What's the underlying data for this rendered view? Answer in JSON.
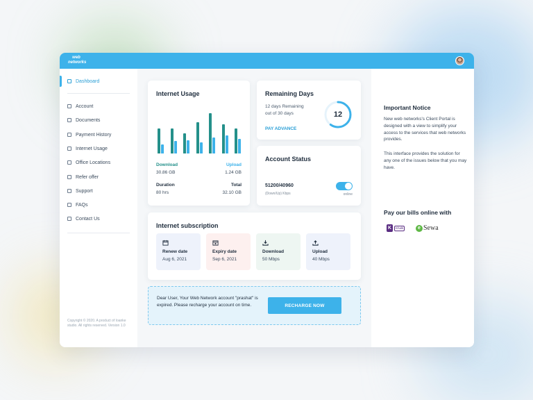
{
  "colors": {
    "accent": "#3db2ea",
    "download": "#24908a",
    "upload": "#3db2ea"
  },
  "header": {
    "logo_text": "web networks"
  },
  "sidebar": {
    "items": [
      {
        "label": "Dashboard",
        "icon": "grid-icon"
      },
      {
        "label": "Account",
        "icon": "account-icon"
      },
      {
        "label": "Documents",
        "icon": "document-icon"
      },
      {
        "label": "Payment History",
        "icon": "payment-icon"
      },
      {
        "label": "Internet Usage",
        "icon": "usage-icon"
      },
      {
        "label": "Office Locations",
        "icon": "location-icon"
      },
      {
        "label": "Refer offer",
        "icon": "refer-icon"
      },
      {
        "label": "Support",
        "icon": "support-icon"
      },
      {
        "label": "FAQs",
        "icon": "faq-icon"
      },
      {
        "label": "Contact Us",
        "icon": "globe-icon"
      }
    ],
    "copyright": "Copyright © 2020. A product of Ioanke studio. All rights reserved. Version 1.0"
  },
  "usage": {
    "title": "Internet Usage",
    "download_label": "Download",
    "download_value": "30.86 GB",
    "upload_label": "Upload",
    "upload_value": "1.24 GB",
    "duration_label": "Duration",
    "duration_value": "80 hrs",
    "total_label": "Total",
    "total_value": "32.10 GB"
  },
  "chart_data": {
    "type": "bar",
    "series": [
      {
        "values": [
          55,
          55,
          45,
          70,
          90,
          65,
          55
        ]
      },
      {
        "values": [
          20,
          28,
          30,
          25,
          35,
          40,
          32
        ]
      }
    ]
  },
  "remaining": {
    "title": "Remaining Days",
    "line1": "12 days  Remaining",
    "line2": "out of 30 days",
    "days": "12",
    "progress": 0.6,
    "pay_label": "PAY ADVANCE"
  },
  "status": {
    "title": "Account Status",
    "speed": "51200/40960",
    "speed_sub": "(Down/Up) Kbps",
    "online": "online"
  },
  "subscription": {
    "title": "Internet subscription",
    "tiles": [
      {
        "label": "Renew date",
        "value": "Aug 6, 2021",
        "icon": "calendar-icon",
        "bg": "#eef2fb"
      },
      {
        "label": "Expiry date",
        "value": "Sep 6, 2021",
        "icon": "calendar-x-icon",
        "bg": "#fdf0ef"
      },
      {
        "label": "Download",
        "value": "50 Mbps",
        "icon": "download-icon",
        "bg": "#eef6f2"
      },
      {
        "label": "Upload",
        "value": "40 Mbps",
        "icon": "upload-icon",
        "bg": "#eef2fb"
      }
    ]
  },
  "alert": {
    "message": "Dear User, Your Web Network account \"prashat\" is expired. Please recharge your account on time.",
    "button": "RECHARGE NOW"
  },
  "notice": {
    "title": "Important Notice",
    "para1": "New web networks's Client Portal is designed with a view to simplify your access to the services that web networks provides.",
    "para2": "This interface provides the solution for any one of the issues below that you may have."
  },
  "payment": {
    "title": "Pay our bills online with",
    "khalti_letter": "K",
    "khalti_word": "Khalti",
    "esewa_letter": "e",
    "esewa_word": "Sewa"
  }
}
